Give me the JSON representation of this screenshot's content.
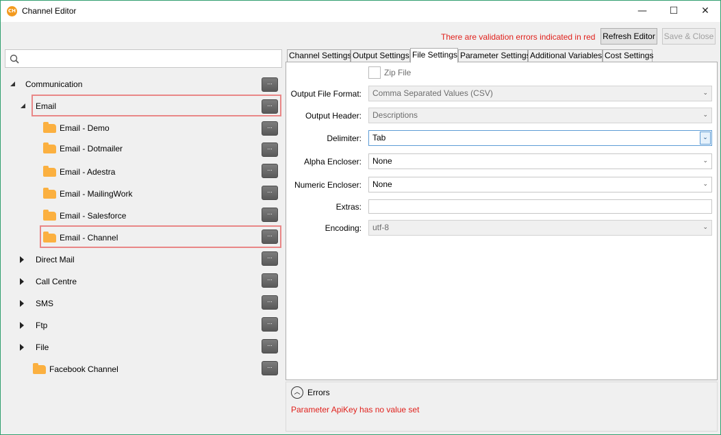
{
  "window": {
    "icon_text": "CH",
    "title": "Channel Editor",
    "minimize": "—",
    "maximize": "☐",
    "close": "✕"
  },
  "header": {
    "validation_message": "There are validation errors indicated in red",
    "refresh_label": "Refresh Editor",
    "save_close_label": "Save & Close"
  },
  "search": {
    "placeholder": "",
    "value": ""
  },
  "tree": {
    "dots": "...",
    "items": [
      {
        "label": "Communication",
        "expander": "expanded"
      },
      {
        "label": "Email",
        "expander": "expanded"
      },
      {
        "label": "Email - Demo",
        "icon": "folder-icon"
      },
      {
        "label": "Email - Dotmailer",
        "icon": "folder-icon"
      },
      {
        "label": "Email - Adestra",
        "icon": "folder-icon"
      },
      {
        "label": "Email - MailingWork",
        "icon": "folder-icon"
      },
      {
        "label": "Email - Salesforce",
        "icon": "folder-icon"
      },
      {
        "label": "Email - Channel",
        "icon": "folder-icon"
      },
      {
        "label": "Direct Mail",
        "expander": "collapsed"
      },
      {
        "label": "Call Centre",
        "expander": "collapsed"
      },
      {
        "label": "SMS",
        "expander": "collapsed"
      },
      {
        "label": "Ftp",
        "expander": "collapsed"
      },
      {
        "label": "File",
        "expander": "collapsed"
      },
      {
        "label": "Facebook Channel",
        "icon": "folder-icon"
      }
    ],
    "error_color": "#e98686"
  },
  "tabs": [
    {
      "label": "Channel Settings"
    },
    {
      "label": "Output Settings"
    },
    {
      "label": "File Settings",
      "active": true
    },
    {
      "label": "Parameter Settings"
    },
    {
      "label": "Additional Variables"
    },
    {
      "label": "Cost Settings"
    }
  ],
  "file_settings": {
    "zip_file_label": "Zip File",
    "zip_file_checked": false,
    "output_file_format": {
      "label": "Output File Format:",
      "value": "Comma Separated Values (CSV)"
    },
    "output_header": {
      "label": "Output Header:",
      "value": "Descriptions"
    },
    "delimiter": {
      "label": "Delimiter:",
      "value": "Tab"
    },
    "alpha_encloser": {
      "label": "Alpha Encloser:",
      "value": "None"
    },
    "numeric_encloser": {
      "label": "Numeric Encloser:",
      "value": "None"
    },
    "extras": {
      "label": "Extras:",
      "value": ""
    },
    "encoding": {
      "label": "Encoding:",
      "value": "utf-8"
    }
  },
  "errors": {
    "toggle_icon": "︿",
    "title": "Errors",
    "message": "Parameter ApiKey has no value set",
    "color": "#e0201b"
  }
}
